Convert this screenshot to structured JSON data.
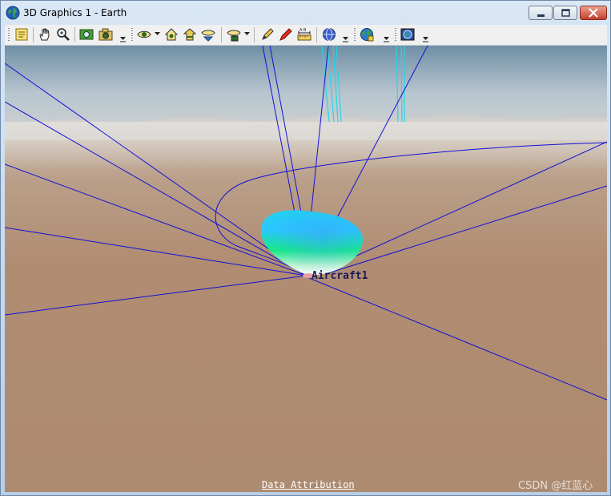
{
  "window": {
    "title": "3D Graphics 1 - Earth",
    "title_icon": "globe-icon"
  },
  "toolbar": {
    "buttons": [
      {
        "name": "properties-icon"
      },
      {
        "name": "pan-hand-icon"
      },
      {
        "name": "zoom-icon"
      },
      {
        "name": "view-options-icon"
      },
      {
        "name": "snapshot-icon"
      },
      {
        "name": "view-from-to-icon"
      },
      {
        "name": "home-view-icon"
      },
      {
        "name": "zoom-to-icon"
      },
      {
        "name": "view-orientation-icon"
      },
      {
        "name": "object-view-icon"
      },
      {
        "name": "pencil-icon"
      },
      {
        "name": "marker-icon"
      },
      {
        "name": "measure-ruler-icon"
      },
      {
        "name": "globe-view-icon"
      },
      {
        "name": "globe-manager-icon"
      },
      {
        "name": "map-layers-icon"
      }
    ]
  },
  "scene": {
    "object_label": "Aircraft1",
    "link_color": "#1010d8",
    "cyan_color": "#22d8e8",
    "ground_color": "#b08c72"
  },
  "footer": {
    "data_attribution": "Data Attribution",
    "watermark": "CSDN @红蓝心"
  }
}
